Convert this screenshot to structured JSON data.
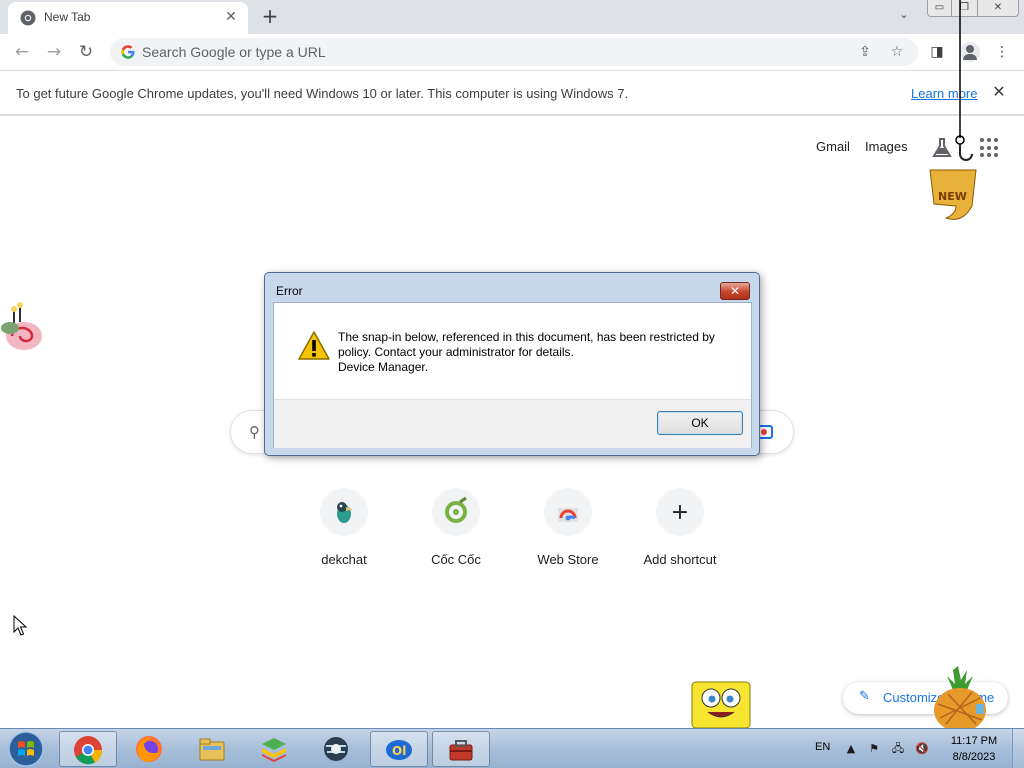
{
  "browser": {
    "tab": {
      "title": "New Tab",
      "close": "✕"
    },
    "new_tab": "+",
    "tab_search": "⌄",
    "window_controls": {
      "minimize": "▭",
      "restore": "❐",
      "close": "✕"
    },
    "omnibox": {
      "placeholder": "Search Google or type a URL"
    },
    "toolbar_icons": [
      "share-icon",
      "star-icon",
      "side-panel-icon",
      "profile-icon",
      "menu-icon"
    ]
  },
  "infobar": {
    "message": "To get future Google Chrome updates, you'll need Windows 10 or later. This computer is using Windows 7.",
    "link": "Learn more",
    "close": "✕"
  },
  "ntp": {
    "header_links": [
      "Gmail",
      "Images"
    ],
    "shortcuts": [
      {
        "label": "dekchat",
        "icon": "dekchat-icon"
      },
      {
        "label": "Cốc Cốc",
        "icon": "coccoc-icon"
      },
      {
        "label": "Web Store",
        "icon": "webstore-icon"
      },
      {
        "label": "Add shortcut",
        "icon": "plus-icon",
        "glyph": "+"
      }
    ],
    "customize": "Customize Chrome"
  },
  "dialog": {
    "title": "Error",
    "close": "✕",
    "message_lines": [
      "The snap-in below, referenced in this document, has been restricted by",
      "policy. Contact your administrator for details.",
      "Device Manager."
    ],
    "ok": "OK"
  },
  "taskbar": {
    "apps": [
      "chrome-icon",
      "firefox-icon",
      "file-explorer-icon",
      "bluestacks-icon",
      "network-app-icon",
      "app-icon",
      "toolbox-icon"
    ],
    "language": "EN",
    "tray_arrow": "▲",
    "time": "11:17 PM",
    "date": "8/8/2023"
  },
  "colors": {
    "chrome_accent": "#1a73e8",
    "dialog_frame": "#c7d8ec",
    "taskbar": "#a8bfd9"
  }
}
